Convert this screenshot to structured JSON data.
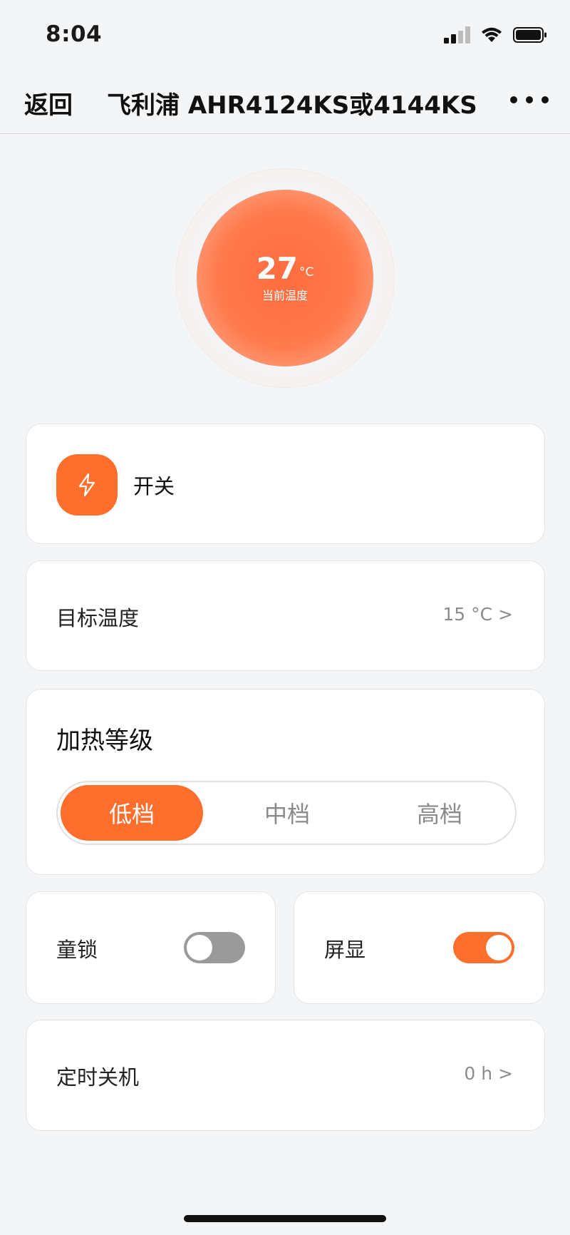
{
  "status_bar": {
    "time": "8:04",
    "icons": [
      "cellular-signal-icon",
      "wifi-icon",
      "battery-icon"
    ]
  },
  "nav": {
    "back_label": "返回",
    "title": "飞利浦 AHR4124KS或4144KS",
    "more_icon": "more-dots-icon"
  },
  "gauge": {
    "temperature": "27",
    "unit": "°C",
    "caption": "当前温度"
  },
  "power": {
    "icon": "lightning-icon",
    "label": "开关"
  },
  "target_temp": {
    "label": "目标温度",
    "value": "15 °C >"
  },
  "heat_level": {
    "title": "加热等级",
    "options": [
      "低档",
      "中档",
      "高档"
    ],
    "selected": "低档"
  },
  "child_lock": {
    "label": "童锁",
    "on": false
  },
  "screen_display": {
    "label": "屏显",
    "on": true
  },
  "timer_off": {
    "label": "定时关机",
    "value": "0 h >"
  },
  "colors": {
    "accent": "#ff6e2c",
    "background": "#f4f5f7",
    "toggle_off": "#9a9a9a"
  }
}
